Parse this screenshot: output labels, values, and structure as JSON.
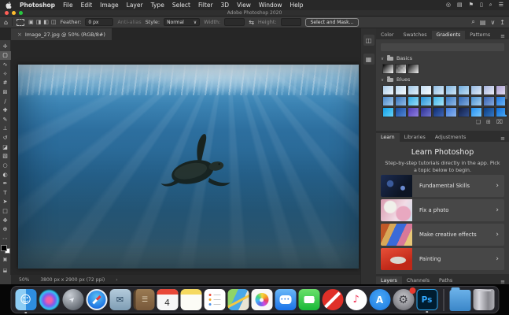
{
  "menu_bar": {
    "items": [
      "Photoshop",
      "File",
      "Edit",
      "Image",
      "Layer",
      "Type",
      "Select",
      "Filter",
      "3D",
      "View",
      "Window",
      "Help"
    ],
    "status_icons": [
      {
        "name": "screen-mirroring-icon",
        "glyph": "◎"
      },
      {
        "name": "display-icon",
        "glyph": "▤"
      },
      {
        "name": "location-icon",
        "glyph": "⚑"
      },
      {
        "name": "battery-icon",
        "glyph": "▯"
      },
      {
        "name": "search-icon",
        "glyph": "⌕"
      },
      {
        "name": "control-center-icon",
        "glyph": "☰"
      }
    ]
  },
  "title_bar": {
    "title": "Adobe Photoshop 2020"
  },
  "options_bar": {
    "home_icon": "⌂",
    "mode_icons": [
      "▣",
      "◨",
      "◧",
      "◫"
    ],
    "feather_label": "Feather:",
    "feather_value": "0 px",
    "anti_alias_label": "Anti-alias",
    "style_label": "Style:",
    "style_value": "Normal",
    "dropdown_arrow": "∨",
    "width_label": "Width:",
    "width_value": "",
    "link_icon": "⇆",
    "height_label": "Height:",
    "height_value": "",
    "select_and_mask_label": "Select and Mask...",
    "right_icons": [
      {
        "name": "search-icon",
        "glyph": "⌕"
      },
      {
        "name": "workspace-icon",
        "glyph": "▤"
      },
      {
        "name": "chevron-down-icon",
        "glyph": "∨"
      },
      {
        "name": "share-icon",
        "glyph": "↥"
      }
    ]
  },
  "document_tab": {
    "close": "×",
    "label": "Image_27.jpg @ 50% (RGB/8#)"
  },
  "tools": [
    {
      "name": "move-tool",
      "glyph": "✛"
    },
    {
      "name": "marquee-tool",
      "glyph": "▢",
      "active": true
    },
    {
      "name": "lasso-tool",
      "glyph": "∿"
    },
    {
      "name": "quick-selection-tool",
      "glyph": "✧"
    },
    {
      "name": "crop-tool",
      "glyph": "#"
    },
    {
      "name": "frame-tool",
      "glyph": "⊠"
    },
    {
      "name": "eyedropper-tool",
      "glyph": "∕"
    },
    {
      "name": "healing-brush-tool",
      "glyph": "✚"
    },
    {
      "name": "brush-tool",
      "glyph": "✎"
    },
    {
      "name": "clone-stamp-tool",
      "glyph": "⊥"
    },
    {
      "name": "history-brush-tool",
      "glyph": "↺"
    },
    {
      "name": "eraser-tool",
      "glyph": "◪"
    },
    {
      "name": "gradient-tool",
      "glyph": "▧"
    },
    {
      "name": "blur-tool",
      "glyph": "○"
    },
    {
      "name": "dodge-tool",
      "glyph": "◐"
    },
    {
      "name": "pen-tool",
      "glyph": "✒"
    },
    {
      "name": "type-tool",
      "glyph": "T"
    },
    {
      "name": "path-selection-tool",
      "glyph": "➤"
    },
    {
      "name": "rectangle-tool",
      "glyph": "□"
    },
    {
      "name": "hand-tool",
      "glyph": "✥"
    },
    {
      "name": "zoom-tool",
      "glyph": "⊕"
    },
    {
      "name": "toolbar-ellipsis",
      "glyph": "⋯"
    }
  ],
  "tool_bottom_icons": [
    {
      "name": "quick-mask-icon",
      "glyph": "▣"
    },
    {
      "name": "screen-mode-icon",
      "glyph": "⬓"
    }
  ],
  "canvas": {
    "alt": "Underwater photograph of a sea turtle swimming beneath sun rays"
  },
  "status_bar": {
    "zoom_value": "50%",
    "dimensions": "3800 px x 2900 px (72 ppi)",
    "chevron": "›"
  },
  "panel_strip_icons": [
    {
      "name": "libraries-panel-icon",
      "glyph": "◫"
    },
    {
      "name": "adjustments-panel-icon",
      "glyph": "▦"
    }
  ],
  "gradients_panel": {
    "tabs": [
      "Color",
      "Swatches",
      "Gradients",
      "Patterns"
    ],
    "active_tab": "Gradients",
    "menu_icon": "≡",
    "groups": {
      "basics": "Basics",
      "blues": "Blues"
    },
    "disclosure": "∨",
    "basics_swatches": [
      {
        "from": "#000000",
        "to": "#ffffff"
      },
      {
        "from": "#000000",
        "to": "#ffffff",
        "checker": true
      },
      {
        "from": "#111111",
        "to": "#f5f5f5"
      }
    ],
    "blues_swatches": [
      {
        "from": "#a9cbe8",
        "to": "#f0f7fc"
      },
      {
        "from": "#b9d6ee",
        "to": "#f6fbfe"
      },
      {
        "from": "#9ec6e6",
        "to": "#e4f1fa"
      },
      {
        "from": "#c2dcf2",
        "to": "#f8fcfe"
      },
      {
        "from": "#8fbce2",
        "to": "#dcedf8"
      },
      {
        "from": "#7bb2e0",
        "to": "#cfe6f6"
      },
      {
        "from": "#6ca8dc",
        "to": "#c2def2"
      },
      {
        "from": "#93b8e2",
        "to": "#e2ecf8"
      },
      {
        "from": "#a4b2dc",
        "to": "#e9ecf7"
      },
      {
        "from": "#ab9fd2",
        "to": "#e5e0f2"
      },
      {
        "from": "#4a86c8",
        "to": "#a6cdee"
      },
      {
        "from": "#3672ba",
        "to": "#90bce8"
      },
      {
        "from": "#2fa8e6",
        "to": "#9adef6"
      },
      {
        "from": "#2490d6",
        "to": "#86ccf2"
      },
      {
        "from": "#3cb2e8",
        "to": "#a8e6f8"
      },
      {
        "from": "#3678c2",
        "to": "#92baea"
      },
      {
        "from": "#2e66b6",
        "to": "#82acdf"
      },
      {
        "from": "#4790d2",
        "to": "#aad2f1"
      },
      {
        "from": "#3662b0",
        "to": "#84a8de"
      },
      {
        "from": "#1f78e2",
        "to": "#70b8f5"
      },
      {
        "from": "#12a0e8",
        "to": "#66d2f7"
      },
      {
        "from": "#16489e",
        "to": "#5288d5"
      },
      {
        "from": "#4e3cb6",
        "to": "#9080e0"
      },
      {
        "from": "#2c2f92",
        "to": "#7074ce"
      },
      {
        "from": "#0e2c70",
        "to": "#4066b6"
      },
      {
        "from": "#3e78da",
        "to": "#8cb6ee"
      },
      {
        "from": "#121e46",
        "to": "#325090"
      },
      {
        "from": "#2290f2",
        "to": "#7cc8fb"
      },
      {
        "from": "#0c3c80",
        "to": "#3478c6"
      },
      {
        "from": "#0e6cda",
        "to": "#4eacf4"
      }
    ],
    "footer_icons": [
      {
        "name": "new-group-icon",
        "glyph": "❏"
      },
      {
        "name": "new-gradient-icon",
        "glyph": "⊞"
      },
      {
        "name": "delete-icon",
        "glyph": "⌧"
      }
    ]
  },
  "learn_panel": {
    "tabs": [
      "Learn",
      "Libraries",
      "Adjustments"
    ],
    "active_tab": "Learn",
    "menu_icon": "≡",
    "title": "Learn Photoshop",
    "subtitle": "Step-by-step tutorials directly in the app. Pick a topic below to begin.",
    "chevron": "›",
    "cards": [
      {
        "label": "Fundamental Skills",
        "thumb": "fundamental"
      },
      {
        "label": "Fix a photo",
        "thumb": "photo"
      },
      {
        "label": "Make creative effects",
        "thumb": "effects"
      },
      {
        "label": "Painting",
        "thumb": "painting"
      }
    ]
  },
  "bottom_panel_tabs": {
    "tabs": [
      "Layers",
      "Channels",
      "Paths"
    ],
    "active_tab": "Layers",
    "menu_icon": "≡"
  },
  "dock": {
    "apps": [
      {
        "name": "finder",
        "running": true
      },
      {
        "name": "siri"
      },
      {
        "name": "launchpad"
      },
      {
        "name": "safari"
      },
      {
        "name": "mail"
      },
      {
        "name": "contacts"
      },
      {
        "name": "calendar"
      },
      {
        "name": "notes"
      },
      {
        "name": "reminders"
      },
      {
        "name": "maps"
      },
      {
        "name": "photos"
      },
      {
        "name": "messages"
      },
      {
        "name": "facetime"
      },
      {
        "name": "do-not-enter"
      },
      {
        "name": "music"
      },
      {
        "name": "app-store"
      },
      {
        "name": "system-preferences"
      },
      {
        "name": "photoshop",
        "running": true
      }
    ],
    "trailing": [
      {
        "name": "downloads"
      },
      {
        "name": "trash"
      }
    ],
    "calendar_day": "4",
    "photoshop_label": "Ps",
    "glyphs": {
      "finder": "☺",
      "launchpad": "➤",
      "mail": "✉",
      "contacts": "☰",
      "music": "♪",
      "app-store": "A",
      "system-preferences": "⚙",
      "messages": "•••"
    }
  }
}
